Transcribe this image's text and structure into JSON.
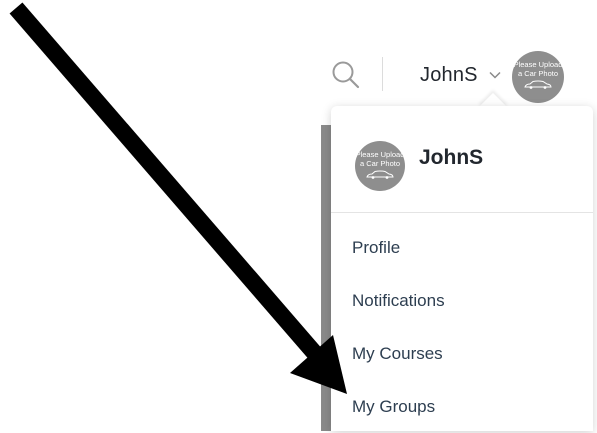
{
  "header": {
    "username": "JohnS",
    "avatar_text": "Please Upload a Car Photo",
    "icons": {
      "search": "search-icon",
      "chevron": "chevron-down-icon",
      "car": "car-icon",
      "arrow": "arrow-annotation"
    }
  },
  "menu": {
    "username": "JohnS",
    "avatar_text": "Please Upload a Car Photo",
    "items": [
      {
        "label": "Profile"
      },
      {
        "label": "Notifications"
      },
      {
        "label": "My Courses"
      },
      {
        "label": "My Groups"
      }
    ]
  },
  "colors": {
    "avatar_bg": "#8e8e8e",
    "text_dark": "#22272e",
    "menu_text": "#2d3e50",
    "arrow": "#000000"
  }
}
